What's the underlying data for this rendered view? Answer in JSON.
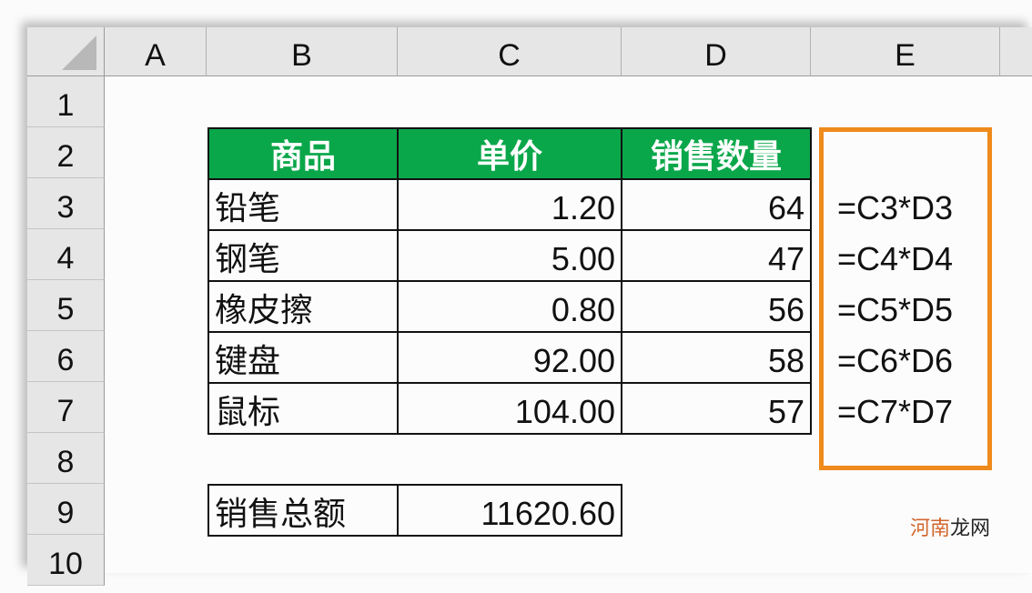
{
  "columns": [
    "A",
    "B",
    "C",
    "D",
    "E"
  ],
  "rows": [
    "1",
    "2",
    "3",
    "4",
    "5",
    "6",
    "7",
    "8",
    "9",
    "10"
  ],
  "table": {
    "headers": [
      "商品",
      "单价",
      "销售数量"
    ],
    "rows": [
      {
        "item": "铅笔",
        "price": "1.20",
        "qty": "64",
        "formula": "=C3*D3"
      },
      {
        "item": "钢笔",
        "price": "5.00",
        "qty": "47",
        "formula": "=C4*D4"
      },
      {
        "item": "橡皮擦",
        "price": "0.80",
        "qty": "56",
        "formula": "=C5*D5"
      },
      {
        "item": "键盘",
        "price": "92.00",
        "qty": "58",
        "formula": "=C6*D6"
      },
      {
        "item": "鼠标",
        "price": "104.00",
        "qty": "57",
        "formula": "=C7*D7"
      }
    ]
  },
  "total": {
    "label": "销售总额",
    "value": "11620.60"
  },
  "colors": {
    "header_green": "#0aa74a",
    "highlight_orange": "#ef8a1c"
  },
  "watermark": {
    "part1": "河南",
    "part2": "龙网"
  }
}
